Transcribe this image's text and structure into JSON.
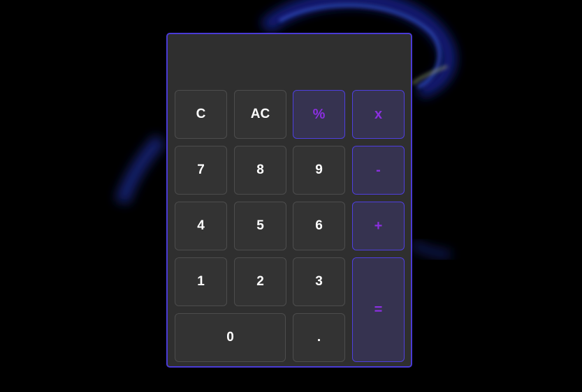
{
  "display": {
    "value": ""
  },
  "keys": {
    "clear": "C",
    "all_clear": "AC",
    "percent": "%",
    "multiply": "x",
    "seven": "7",
    "eight": "8",
    "nine": "9",
    "minus": "-",
    "four": "4",
    "five": "5",
    "six": "6",
    "plus": "+",
    "one": "1",
    "two": "2",
    "three": "3",
    "equals": "=",
    "zero": "0",
    "decimal": "."
  },
  "colors": {
    "background": "#000000",
    "panel": "#2f2f2f",
    "accent_border": "#4a3bd6",
    "operator_text": "#8b2fe0",
    "swirl_blue": "#1a2fa0"
  }
}
